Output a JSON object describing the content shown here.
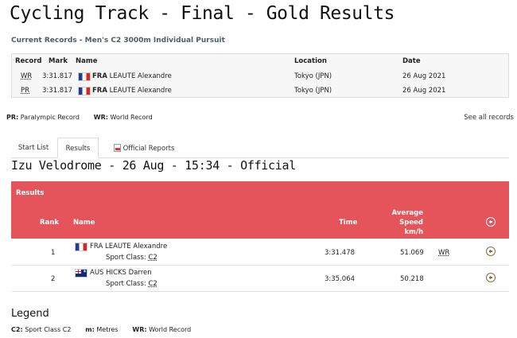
{
  "page": {
    "title": "Cycling Track - Final - Gold Results"
  },
  "records": {
    "subtitle": "Current Records - Men's C2 3000m Individual Pursuit",
    "headers": {
      "record": "Record",
      "mark": "Mark",
      "name": "Name",
      "location": "Location",
      "date": "Date"
    },
    "rows": [
      {
        "record": "WR",
        "mark": "3:31.817",
        "noc": "FRA",
        "athlete": "LEAUTE Alexandre",
        "flag": "fra-flag-icon",
        "location": "Tokyo (JPN)",
        "date": "26 Aug 2021"
      },
      {
        "record": "PR",
        "mark": "3:31.817",
        "noc": "FRA",
        "athlete": "LEAUTE Alexandre",
        "flag": "fra-flag-icon",
        "location": "Tokyo (JPN)",
        "date": "26 Aug 2021"
      }
    ]
  },
  "record_legend": {
    "pr_abbr": "PR:",
    "pr_text": "Paralympic Record",
    "wr_abbr": "WR:",
    "wr_text": "World Record"
  },
  "see_all_records": "See all records",
  "tabs": [
    {
      "label": "Start List",
      "active": false
    },
    {
      "label": "Results",
      "active": true
    },
    {
      "label": "Official Reports",
      "active": false,
      "icon": "pdf-icon"
    }
  ],
  "session_title": "Izu Velodrome - 26 Aug - 15:34 - Official",
  "results": {
    "section_label": "Results",
    "headers": {
      "rank": "Rank",
      "name": "Name",
      "time": "Time",
      "speed_line1": "Average",
      "speed_line2": "Speed",
      "speed_line3": "km/h"
    },
    "accent_color": "#e5545b",
    "rows": [
      {
        "rank": "1",
        "noc": "FRA",
        "athlete": "LEAUTE Alexandre",
        "flag": "fra-flag-icon",
        "class_label": "Sport Class:",
        "class_value": "C2",
        "time": "3:31.478",
        "speed": "51.069",
        "record": "WR"
      },
      {
        "rank": "2",
        "noc": "AUS",
        "athlete": "HICKS Darren",
        "flag": "aus-flag-icon",
        "class_label": "Sport Class:",
        "class_value": "C2",
        "time": "3:35.064",
        "speed": "50.218",
        "record": ""
      }
    ]
  },
  "legend": {
    "title": "Legend",
    "items": [
      {
        "abbr": "C2:",
        "text": "Sport Class C2"
      },
      {
        "abbr": "m:",
        "text": "Metres"
      },
      {
        "abbr": "WR:",
        "text": "World Record"
      }
    ]
  }
}
